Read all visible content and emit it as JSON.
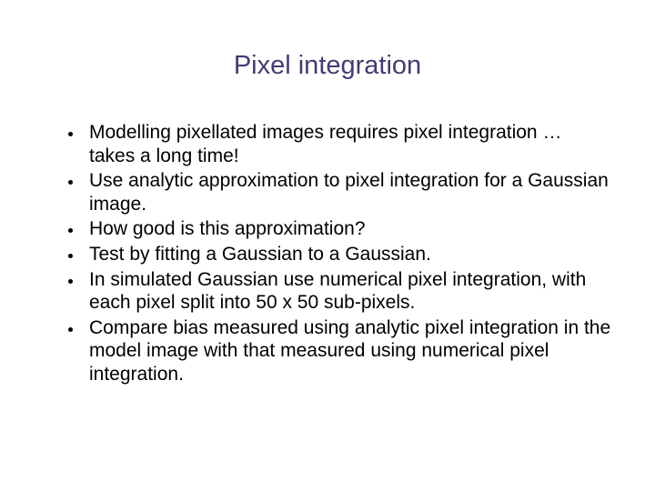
{
  "title": "Pixel integration",
  "bullets": [
    "Modelling pixellated images requires pixel integration … takes a long time!",
    "Use analytic approximation to pixel integration for a Gaussian image.",
    "How good is this approximation?",
    "Test by fitting a Gaussian to a Gaussian.",
    "In simulated Gaussian use numerical pixel integration, with each pixel split into 50 x 50 sub-pixels.",
    "Compare bias measured using analytic pixel integration in the model image with that measured using numerical pixel integration."
  ]
}
